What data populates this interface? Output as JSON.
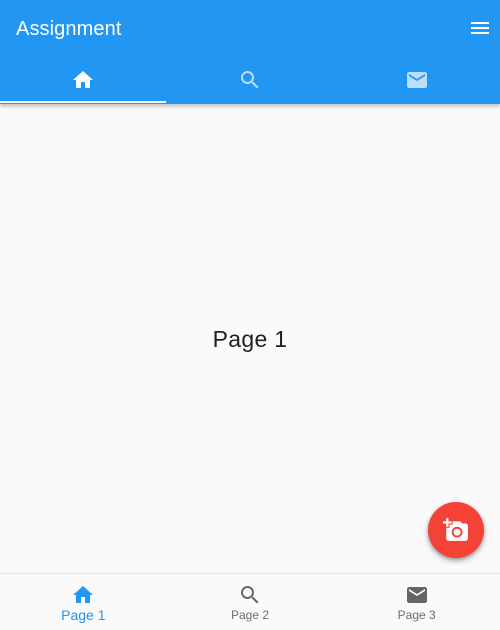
{
  "app_bar": {
    "title": "Assignment",
    "menu_icon": "menu-icon"
  },
  "tabs": [
    {
      "icon": "home-icon",
      "selected": true
    },
    {
      "icon": "search-icon",
      "selected": false
    },
    {
      "icon": "mail-icon",
      "selected": false
    }
  ],
  "content": {
    "heading": "Page 1"
  },
  "fab": {
    "icon": "add-a-photo-icon"
  },
  "bottom_nav": {
    "items": [
      {
        "label": "Page 1",
        "icon": "home-icon",
        "active": true
      },
      {
        "label": "Page 2",
        "icon": "search-icon",
        "active": false
      },
      {
        "label": "Page 3",
        "icon": "mail-icon",
        "active": false
      }
    ]
  },
  "colors": {
    "primary": "#2196f3",
    "fab": "#f44336",
    "inactive_tab_icon": "#bbdefb",
    "inactive_nav": "#6d6d6d"
  }
}
